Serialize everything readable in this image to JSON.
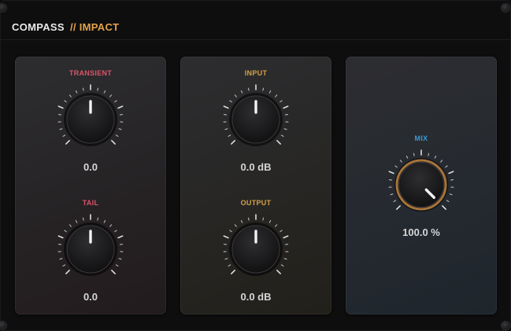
{
  "header": {
    "brand": "COMPASS",
    "section": "// IMPACT"
  },
  "colors": {
    "brand_text": "#e9e9ea",
    "section_accent": "#e3a24a",
    "transient_label": "#d9556a",
    "level_label": "#d4a04a",
    "mix_label": "#3b9bd6",
    "mix_ring": "#a8743a"
  },
  "knobs": {
    "transient": {
      "label": "TRANSIENT",
      "value": "0.0",
      "level": 0.5
    },
    "tail": {
      "label": "TAIL",
      "value": "0.0",
      "level": 0.5
    },
    "input": {
      "label": "INPUT",
      "value": "0.0 dB",
      "level": 0.5
    },
    "output": {
      "label": "OUTPUT",
      "value": "0.0 dB",
      "level": 0.5
    },
    "mix": {
      "label": "MIX",
      "value": "100.0 %",
      "level": 1.0
    }
  }
}
